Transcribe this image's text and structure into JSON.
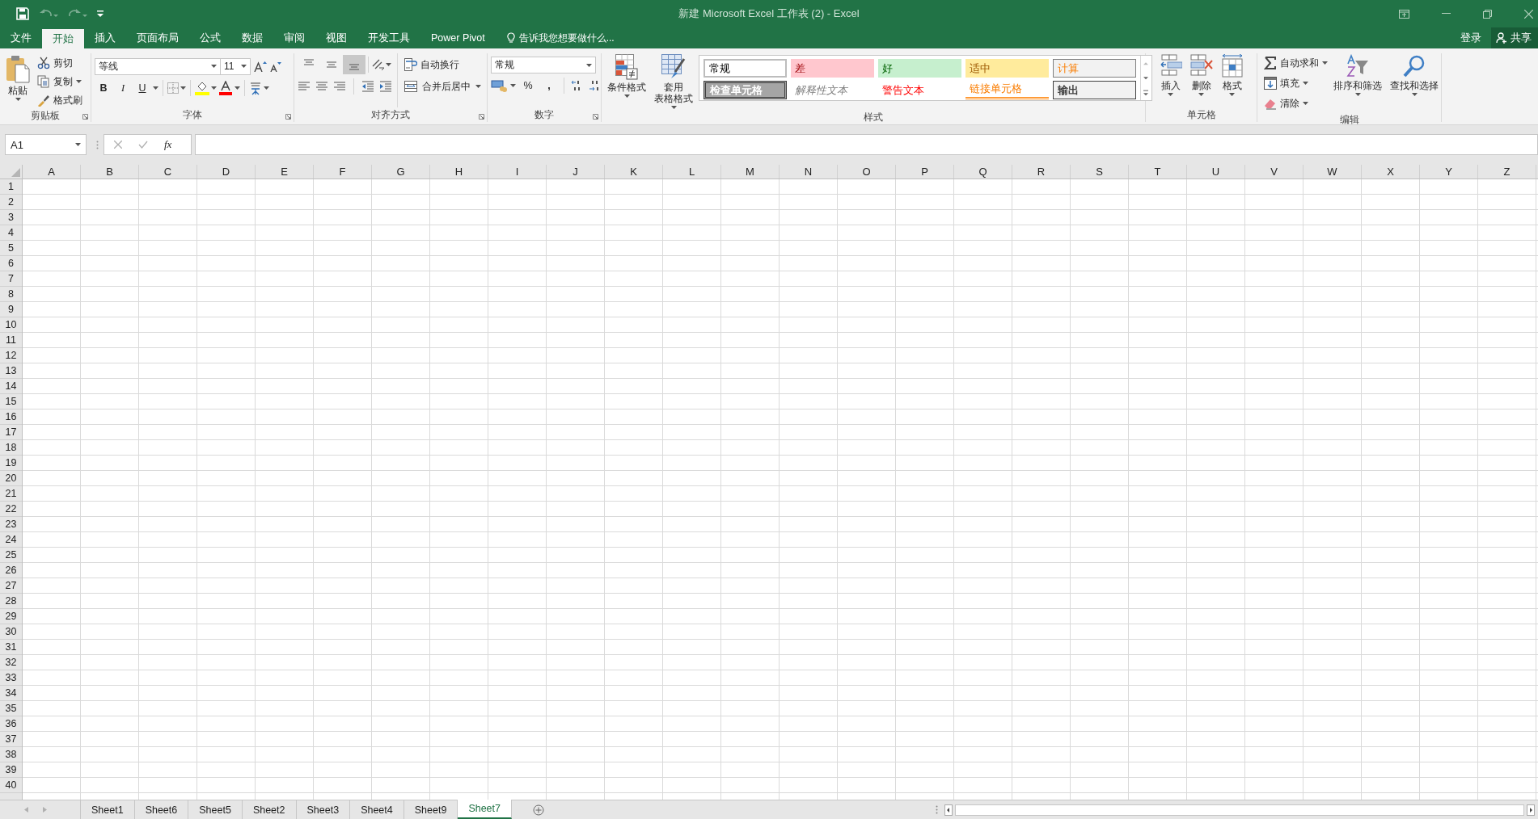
{
  "window": {
    "title": "新建 Microsoft Excel 工作表 (2) - Excel"
  },
  "quick_access": [
    {
      "kind": "save",
      "disabled": false
    },
    {
      "kind": "undo",
      "disabled": true
    },
    {
      "kind": "redo",
      "disabled": true
    },
    {
      "kind": "customize",
      "disabled": false
    }
  ],
  "tabs": [
    {
      "label": "文件",
      "selected": false
    },
    {
      "label": "开始",
      "selected": true
    },
    {
      "label": "插入",
      "selected": false
    },
    {
      "label": "页面布局",
      "selected": false
    },
    {
      "label": "公式",
      "selected": false
    },
    {
      "label": "数据",
      "selected": false
    },
    {
      "label": "审阅",
      "selected": false
    },
    {
      "label": "视图",
      "selected": false
    },
    {
      "label": "开发工具",
      "selected": false
    },
    {
      "label": "Power Pivot",
      "selected": false
    }
  ],
  "tell_me": {
    "text": "告诉我您想要做什么..."
  },
  "account": {
    "sign_in": "登录",
    "share": "共享"
  },
  "ribbon": {
    "clipboard": {
      "label": "剪贴板",
      "paste": "粘贴",
      "actions": [
        {
          "kind": "cut",
          "label": "剪切"
        },
        {
          "kind": "copy",
          "label": "复制"
        },
        {
          "kind": "format_painter",
          "label": "格式刷"
        }
      ]
    },
    "font": {
      "label": "字体",
      "font_name": "等线",
      "font_size": "11",
      "style_buttons": [
        "B",
        "I",
        "U"
      ]
    },
    "alignment": {
      "label": "对齐方式",
      "vertical_align": [
        {
          "selected": false
        },
        {
          "selected": false
        },
        {
          "selected": true
        }
      ],
      "wrap_text": "自动换行",
      "merge_center": "合并后居中"
    },
    "number": {
      "label": "数字",
      "format": "常规",
      "percent": "%",
      "comma": ","
    },
    "styles": {
      "label": "样式",
      "conditional_formatting": "条件格式",
      "format_as_table": [
        "套用",
        "表格格式"
      ],
      "cell_styles": [
        {
          "kind": "normal",
          "label": "常规"
        },
        {
          "kind": "bad",
          "label": "差"
        },
        {
          "kind": "good",
          "label": "好"
        },
        {
          "kind": "neutral",
          "label": "适中"
        },
        {
          "kind": "calculation",
          "label": "计算"
        },
        {
          "kind": "check",
          "label": "检查单元格"
        },
        {
          "kind": "explanatory",
          "label": "解释性文本"
        },
        {
          "kind": "warning",
          "label": "警告文本"
        },
        {
          "kind": "linked",
          "label": "链接单元格"
        },
        {
          "kind": "output",
          "label": "输出"
        }
      ]
    },
    "cells": {
      "label": "单元格",
      "actions": [
        {
          "kind": "insert",
          "label": "插入"
        },
        {
          "kind": "delete",
          "label": "删除"
        },
        {
          "kind": "format",
          "label": "格式"
        }
      ]
    },
    "editing": {
      "label": "编辑",
      "actions": [
        {
          "kind": "autosum",
          "label": "自动求和"
        },
        {
          "kind": "fill",
          "label": "填充"
        },
        {
          "kind": "clear",
          "label": "清除"
        }
      ],
      "big_actions": [
        {
          "kind": "sort_filter",
          "label": "排序和筛选"
        },
        {
          "kind": "find_select",
          "label": "查找和选择"
        }
      ]
    }
  },
  "formula_bar": {
    "name_box": "A1",
    "fx": "fx"
  },
  "sheet": {
    "columns": [
      "A",
      "B",
      "C",
      "D",
      "E",
      "F",
      "G",
      "H",
      "I",
      "J",
      "K",
      "L",
      "M",
      "N",
      "O",
      "P",
      "Q",
      "R",
      "S",
      "T",
      "U",
      "V",
      "W",
      "X",
      "Y",
      "Z"
    ],
    "rows": [
      "1",
      "2",
      "3",
      "4",
      "5",
      "6",
      "7",
      "8",
      "9",
      "10",
      "11",
      "12",
      "13",
      "14",
      "15",
      "16",
      "17",
      "18",
      "19",
      "20",
      "21",
      "22",
      "23",
      "24",
      "25",
      "26",
      "27",
      "28",
      "29",
      "30",
      "31",
      "32",
      "33",
      "34",
      "35",
      "36",
      "37",
      "38",
      "39",
      "40"
    ]
  },
  "sheet_tabs": [
    {
      "label": "Sheet1",
      "selected": false
    },
    {
      "label": "Sheet6",
      "selected": false
    },
    {
      "label": "Sheet5",
      "selected": false
    },
    {
      "label": "Sheet2",
      "selected": false
    },
    {
      "label": "Sheet3",
      "selected": false
    },
    {
      "label": "Sheet4",
      "selected": false
    },
    {
      "label": "Sheet9",
      "selected": false
    },
    {
      "label": "Sheet7",
      "selected": true
    }
  ]
}
